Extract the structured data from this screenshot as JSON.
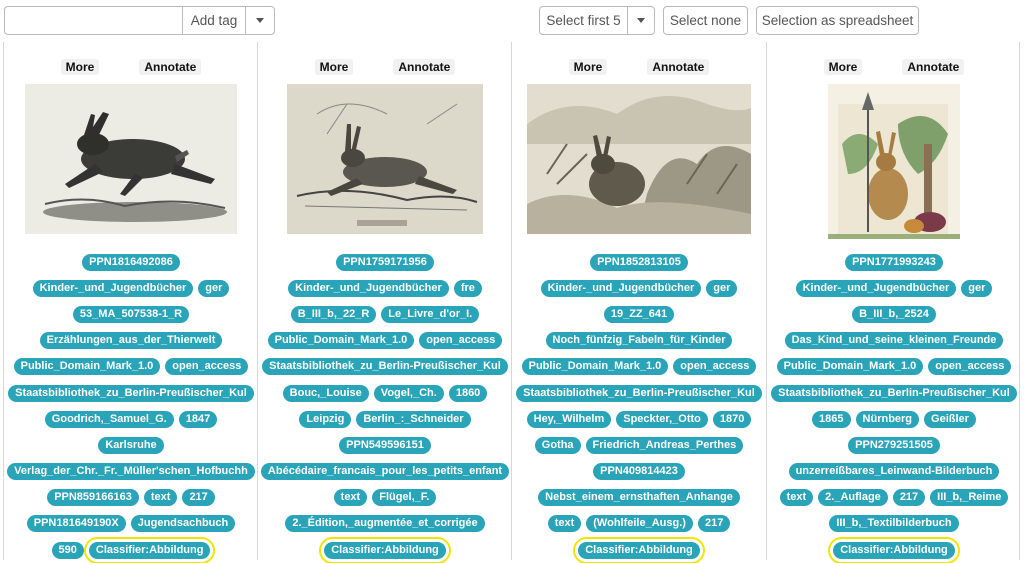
{
  "toolbar": {
    "tag_input_value": "",
    "add_tag_label": "Add tag",
    "select_first_label": "Select first 5",
    "select_none_label": "Select none",
    "spreadsheet_label": "Selection as spreadsheet"
  },
  "card_actions": {
    "more": "More",
    "annotate": "Annotate"
  },
  "columns": [
    {
      "rows": [
        [
          "PPN1816492086"
        ],
        [
          "Kinder-_und_Jugendbücher",
          "ger"
        ],
        [
          "53_MA_507538-1_R"
        ],
        [
          "Erzählungen_aus_der_Thierwelt"
        ],
        [
          "Public_Domain_Mark_1.0",
          "open_access"
        ],
        [
          "Staatsbibliothek_zu_Berlin-Preußischer_Kul"
        ],
        [
          "Goodrich,_Samuel_G.",
          "1847"
        ],
        [
          "Karlsruhe"
        ],
        [
          "Verlag_der_Chr._Fr._Müller'schen_Hofbuchh"
        ],
        [
          "PPN859166163",
          "text",
          "217"
        ],
        [
          "PPN181649190X",
          "Jugendsachbuch"
        ],
        [
          "590",
          "Classifier:Abbildung"
        ]
      ]
    },
    {
      "rows": [
        [
          "PPN1759171956"
        ],
        [
          "Kinder-_und_Jugendbücher",
          "fre"
        ],
        [
          "B_III_b,_22_R",
          "Le_Livre_d'or_I."
        ],
        [
          "Public_Domain_Mark_1.0",
          "open_access"
        ],
        [
          "Staatsbibliothek_zu_Berlin-Preußischer_Kul"
        ],
        [
          "Bouc,_Louise",
          "Vogel,_Ch.",
          "1860"
        ],
        [
          "Leipzig",
          "Berlin_:_Schneider"
        ],
        [
          "PPN549596151"
        ],
        [
          "Abécédaire_francais_pour_les_petits_enfant"
        ],
        [
          "text",
          "Flügel,_F."
        ],
        [
          "2._Édition,_augmentée_et_corrigée"
        ],
        [
          "Classifier:Abbildung"
        ]
      ]
    },
    {
      "rows": [
        [
          "PPN1852813105"
        ],
        [
          "Kinder-_und_Jugendbücher",
          "ger"
        ],
        [
          "19_ZZ_641"
        ],
        [
          "Noch_fünfzig_Fabeln_für_Kinder"
        ],
        [
          "Public_Domain_Mark_1.0",
          "open_access"
        ],
        [
          "Staatsbibliothek_zu_Berlin-Preußischer_Kul"
        ],
        [
          "Hey,_Wilhelm",
          "Speckter,_Otto",
          "1870"
        ],
        [
          "Gotha",
          "Friedrich_Andreas_Perthes"
        ],
        [
          "PPN409814423"
        ],
        [
          "Nebst_einem_ernsthaften_Anhange"
        ],
        [
          "text",
          "(Wohlfeile_Ausg.)",
          "217"
        ],
        [
          "Classifier:Abbildung"
        ]
      ]
    },
    {
      "rows": [
        [
          "PPN1771993243"
        ],
        [
          "Kinder-_und_Jugendbücher",
          "ger"
        ],
        [
          "B_III_b,_2524"
        ],
        [
          "Das_Kind_und_seine_kleinen_Freunde"
        ],
        [
          "Public_Domain_Mark_1.0",
          "open_access"
        ],
        [
          "Staatsbibliothek_zu_Berlin-Preußischer_Kul"
        ],
        [
          "1865",
          "Nürnberg",
          "Geißler"
        ],
        [
          "PPN279251505"
        ],
        [
          "unzerreißbares_Leinwand-Bilderbuch"
        ],
        [
          "text",
          "2._Auflage",
          "217",
          "III_b,_Reime"
        ],
        [
          "III_b,_Textilbilderbuch"
        ],
        [
          "Classifier:Abbildung"
        ]
      ]
    }
  ],
  "highlighted_tag": "Classifier:Abbildung",
  "colors": {
    "tag_bg": "#2aa4b8",
    "highlight": "#f2e400"
  }
}
